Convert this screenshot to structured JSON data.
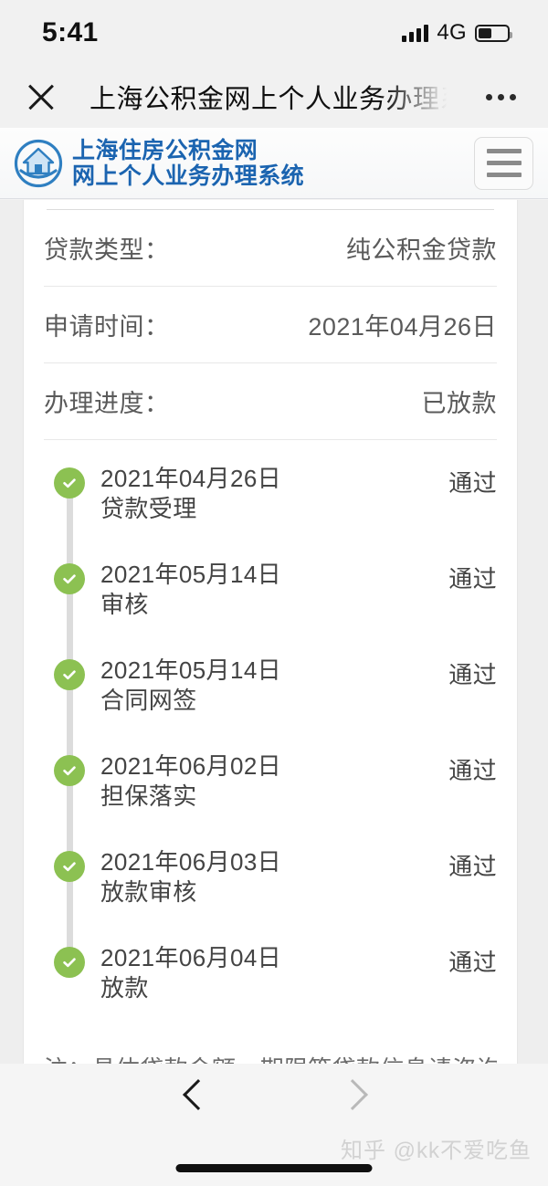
{
  "status_bar": {
    "time": "5:41",
    "network": "4G",
    "signal_icon": "signal-bars-icon",
    "battery_icon": "battery-icon"
  },
  "nav_bar": {
    "close_icon": "close-icon",
    "title": "上海公积金网上个人业务办理系统",
    "more_icon": "more-dots-icon"
  },
  "site_header": {
    "logo_icon": "house-circle-logo-icon",
    "title_line1": "上海住房公积金网",
    "title_line2": "网上个人业务办理系统",
    "menu_icon": "hamburger-menu-icon",
    "brand_color": "#1b64b0"
  },
  "info_rows": [
    {
      "label": "贷款类型：",
      "value": "纯公积金贷款"
    },
    {
      "label": "申请时间：",
      "value": "2021年04月26日"
    },
    {
      "label": "办理进度：",
      "value": "已放款"
    }
  ],
  "timeline": {
    "status_color": "#8cc152",
    "items": [
      {
        "date": "2021年04月26日",
        "name": "贷款受理",
        "status": "通过",
        "icon": "check-circle-icon"
      },
      {
        "date": "2021年05月14日",
        "name": "审核",
        "status": "通过",
        "icon": "check-circle-icon"
      },
      {
        "date": "2021年05月14日",
        "name": "合同网签",
        "status": "通过",
        "icon": "check-circle-icon"
      },
      {
        "date": "2021年06月02日",
        "name": "担保落实",
        "status": "通过",
        "icon": "check-circle-icon"
      },
      {
        "date": "2021年06月03日",
        "name": "放款审核",
        "status": "通过",
        "icon": "check-circle-icon"
      },
      {
        "date": "2021年06月04日",
        "name": "放款",
        "status": "通过",
        "icon": "check-circle-icon"
      }
    ]
  },
  "note": "注：具体贷款金额、期限等贷款信息请咨询贷",
  "bottom_bar": {
    "back_icon": "chevron-left-icon",
    "forward_icon": "chevron-right-icon",
    "home_indicator": "home-indicator-bar",
    "watermark": "知乎 @kk不爱吃鱼"
  }
}
